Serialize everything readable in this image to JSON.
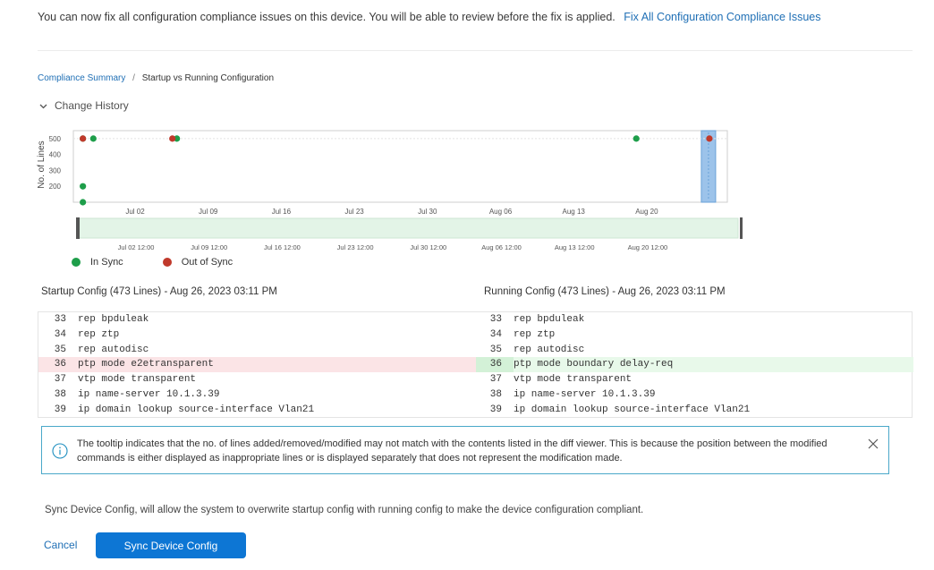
{
  "banner": {
    "message": "You can now fix all configuration compliance issues on this device. You will be able to review before the fix is applied.",
    "link_label": "Fix All Configuration Compliance Issues"
  },
  "breadcrumb": {
    "parent": "Compliance Summary",
    "separator": "/",
    "current": "Startup vs Running Configuration"
  },
  "change_history": {
    "label": "Change History",
    "icon": "chevron-down-icon"
  },
  "chart_data": {
    "type": "scatter",
    "ylabel": "No. of Lines",
    "yticks": [
      200,
      300,
      400,
      500
    ],
    "x_ticks_main": [
      "Jul 02",
      "Jul 09",
      "Jul 16",
      "Jul 23",
      "Jul 30",
      "Aug 06",
      "Aug 13",
      "Aug 20"
    ],
    "x_ticks_navigator": [
      "Jul 02 12:00",
      "Jul 09 12:00",
      "Jul 16 12:00",
      "Jul 23 12:00",
      "Jul 30 12:00",
      "Aug 06 12:00",
      "Aug 13 12:00",
      "Aug 20 12:00"
    ],
    "series": [
      {
        "name": "In Sync",
        "color": "#1e9e4a",
        "points": [
          {
            "x": "Jun 27",
            "y": 500
          },
          {
            "x": "Jun 27",
            "y": 200
          },
          {
            "x": "Jun 27",
            "y": 100
          },
          {
            "x": "Jun 28",
            "y": 500
          },
          {
            "x": "Jul 06",
            "y": 500
          },
          {
            "x": "Aug 19",
            "y": 500
          }
        ]
      },
      {
        "name": "Out of Sync",
        "color": "#c0392b",
        "points": [
          {
            "x": "Jun 27",
            "y": 500
          },
          {
            "x": "Jul 06",
            "y": 500
          },
          {
            "x": "Aug 26",
            "y": 500
          }
        ]
      }
    ],
    "selected_range": "Aug 26",
    "legend_placement": "bottom-left",
    "grid": true
  },
  "legend": [
    {
      "label": "In Sync",
      "color": "#1e9e4a"
    },
    {
      "label": "Out of Sync",
      "color": "#c0392b"
    }
  ],
  "startup": {
    "title": "Startup Config (473 Lines) - Aug 26, 2023 03:11 PM",
    "lines": [
      {
        "num": "33",
        "code": "rep bpduleak"
      },
      {
        "num": "34",
        "code": "rep ztp"
      },
      {
        "num": "35",
        "code": "rep autodisc"
      },
      {
        "num": "36",
        "code": "ptp mode e2etransparent",
        "changed": true
      },
      {
        "num": "37",
        "code": "vtp mode transparent"
      },
      {
        "num": "38",
        "code": "ip name-server 10.1.3.39"
      },
      {
        "num": "39",
        "code": "ip domain lookup source-interface Vlan21"
      }
    ]
  },
  "running": {
    "title": "Running Config (473 Lines) - Aug 26, 2023 03:11 PM",
    "lines": [
      {
        "num": "33",
        "code": "rep bpduleak"
      },
      {
        "num": "34",
        "code": "rep ztp"
      },
      {
        "num": "35",
        "code": "rep autodisc"
      },
      {
        "num": "36",
        "code": "ptp mode boundary delay-req",
        "changed": true
      },
      {
        "num": "37",
        "code": "vtp mode transparent"
      },
      {
        "num": "38",
        "code": "ip name-server 10.1.3.39"
      },
      {
        "num": "39",
        "code": "ip domain lookup source-interface Vlan21"
      }
    ]
  },
  "info": {
    "text": "The tooltip indicates that the no. of lines added/removed/modified may not match with the contents listed in the diff viewer. This is because the position between the modified commands is either displayed as inappropriate lines or is displayed separately that does not represent the modification made."
  },
  "sync_note": "Sync Device Config, will allow the system to overwrite startup config with running config to make the device configuration compliant.",
  "actions": {
    "cancel": "Cancel",
    "sync": "Sync Device Config"
  },
  "colors": {
    "link": "#1f6fb5",
    "primary": "#0d76d4",
    "removed_bg": "#fbe4e6",
    "added_bg": "#e8f9ea",
    "info_border": "#4aa8c9"
  }
}
